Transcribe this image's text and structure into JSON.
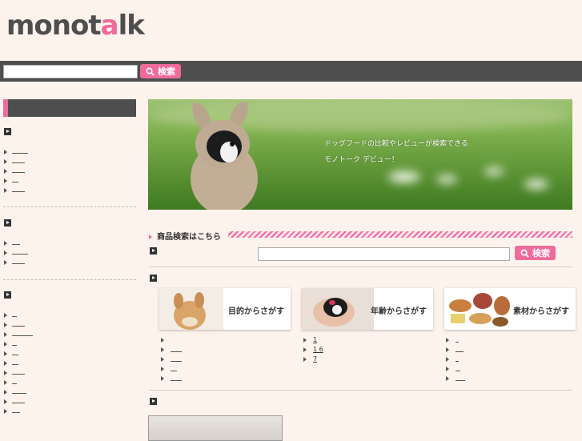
{
  "header": {
    "logo_left": "mono",
    "logo_accent": "t",
    "logo_mid": "a",
    "logo_right": "lk"
  },
  "topsearch": {
    "value": "",
    "button_label": "検索"
  },
  "hero": {
    "line1": "ドッグフードの比較やレビューが検索できる",
    "line2": "モノトーク デビュー！"
  },
  "product_search": {
    "title": "商品検索はこちら",
    "value": "",
    "button_label": "検索"
  },
  "cards": [
    {
      "label": "目的からさがす",
      "links": [
        "",
        "",
        "",
        "",
        ""
      ]
    },
    {
      "label": "年齢からさがす",
      "links": [
        "1",
        "1 6",
        "7"
      ]
    },
    {
      "label": "素材からさがす",
      "links": [
        "",
        "",
        "",
        "",
        ""
      ]
    }
  ],
  "colors": {
    "accent": "#ee6b9b",
    "dark_bar": "#4e4e4e",
    "background": "#fdf3ec"
  },
  "icons": [
    "search-icon",
    "play-bullet-icon"
  ]
}
